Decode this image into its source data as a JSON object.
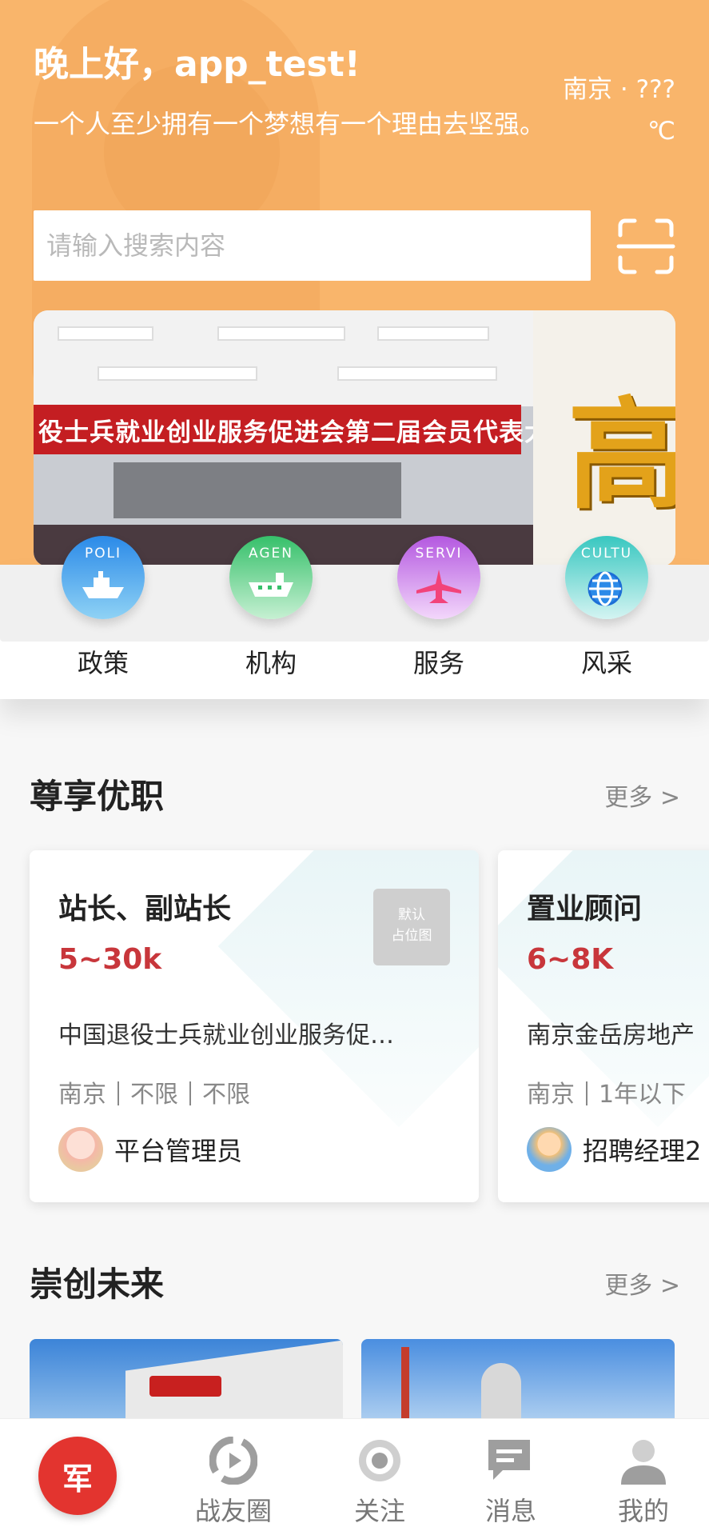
{
  "header": {
    "greeting": "晚上好，app_test!",
    "motto": "一个人至少拥有一个梦想有一个理由去坚强。",
    "weather_city": "南京 · ???",
    "weather_unit": "℃"
  },
  "search": {
    "placeholder": "请输入搜索内容"
  },
  "banner": {
    "caption": "役士兵就业创业服务促进会第二届会员代表大会",
    "side_text": "高"
  },
  "categories": [
    {
      "label": "政策",
      "en": "POLI",
      "icon": "ship-icon",
      "color": "#2b8ae8"
    },
    {
      "label": "机构",
      "en": "AGEN",
      "icon": "carrier-icon",
      "color": "#36c06a"
    },
    {
      "label": "服务",
      "en": "SERVI",
      "icon": "jet-icon",
      "color": "#b458e0"
    },
    {
      "label": "风采",
      "en": "CULTU",
      "icon": "globe-icon",
      "color": "#38c7c0"
    }
  ],
  "jobs_section": {
    "title": "尊享优职",
    "more": "更多 >"
  },
  "jobs": [
    {
      "title": "站长、副站长",
      "salary": "5~30k",
      "company": "中国退役士兵就业创业服务促…",
      "city": "南京",
      "experience": "不限",
      "education": "不限",
      "poster": "平台管理员",
      "placeholder": "默认\n占位图"
    },
    {
      "title": "置业顾问",
      "salary": "6~8K",
      "company": "南京金岳房地产",
      "city": "南京",
      "experience": "1年以下",
      "poster": "招聘经理2"
    }
  ],
  "future_section": {
    "title": "崇创未来",
    "more": "更多 >"
  },
  "tabbar": {
    "home": "军",
    "tabs": [
      {
        "label": "战友圈",
        "icon": "circle-icon"
      },
      {
        "label": "关注",
        "icon": "follow-icon"
      },
      {
        "label": "消息",
        "icon": "message-icon"
      },
      {
        "label": "我的",
        "icon": "profile-icon"
      }
    ]
  },
  "colors": {
    "header": "#f9b56b",
    "salary": "#c8363b",
    "home": "#e3342f"
  }
}
